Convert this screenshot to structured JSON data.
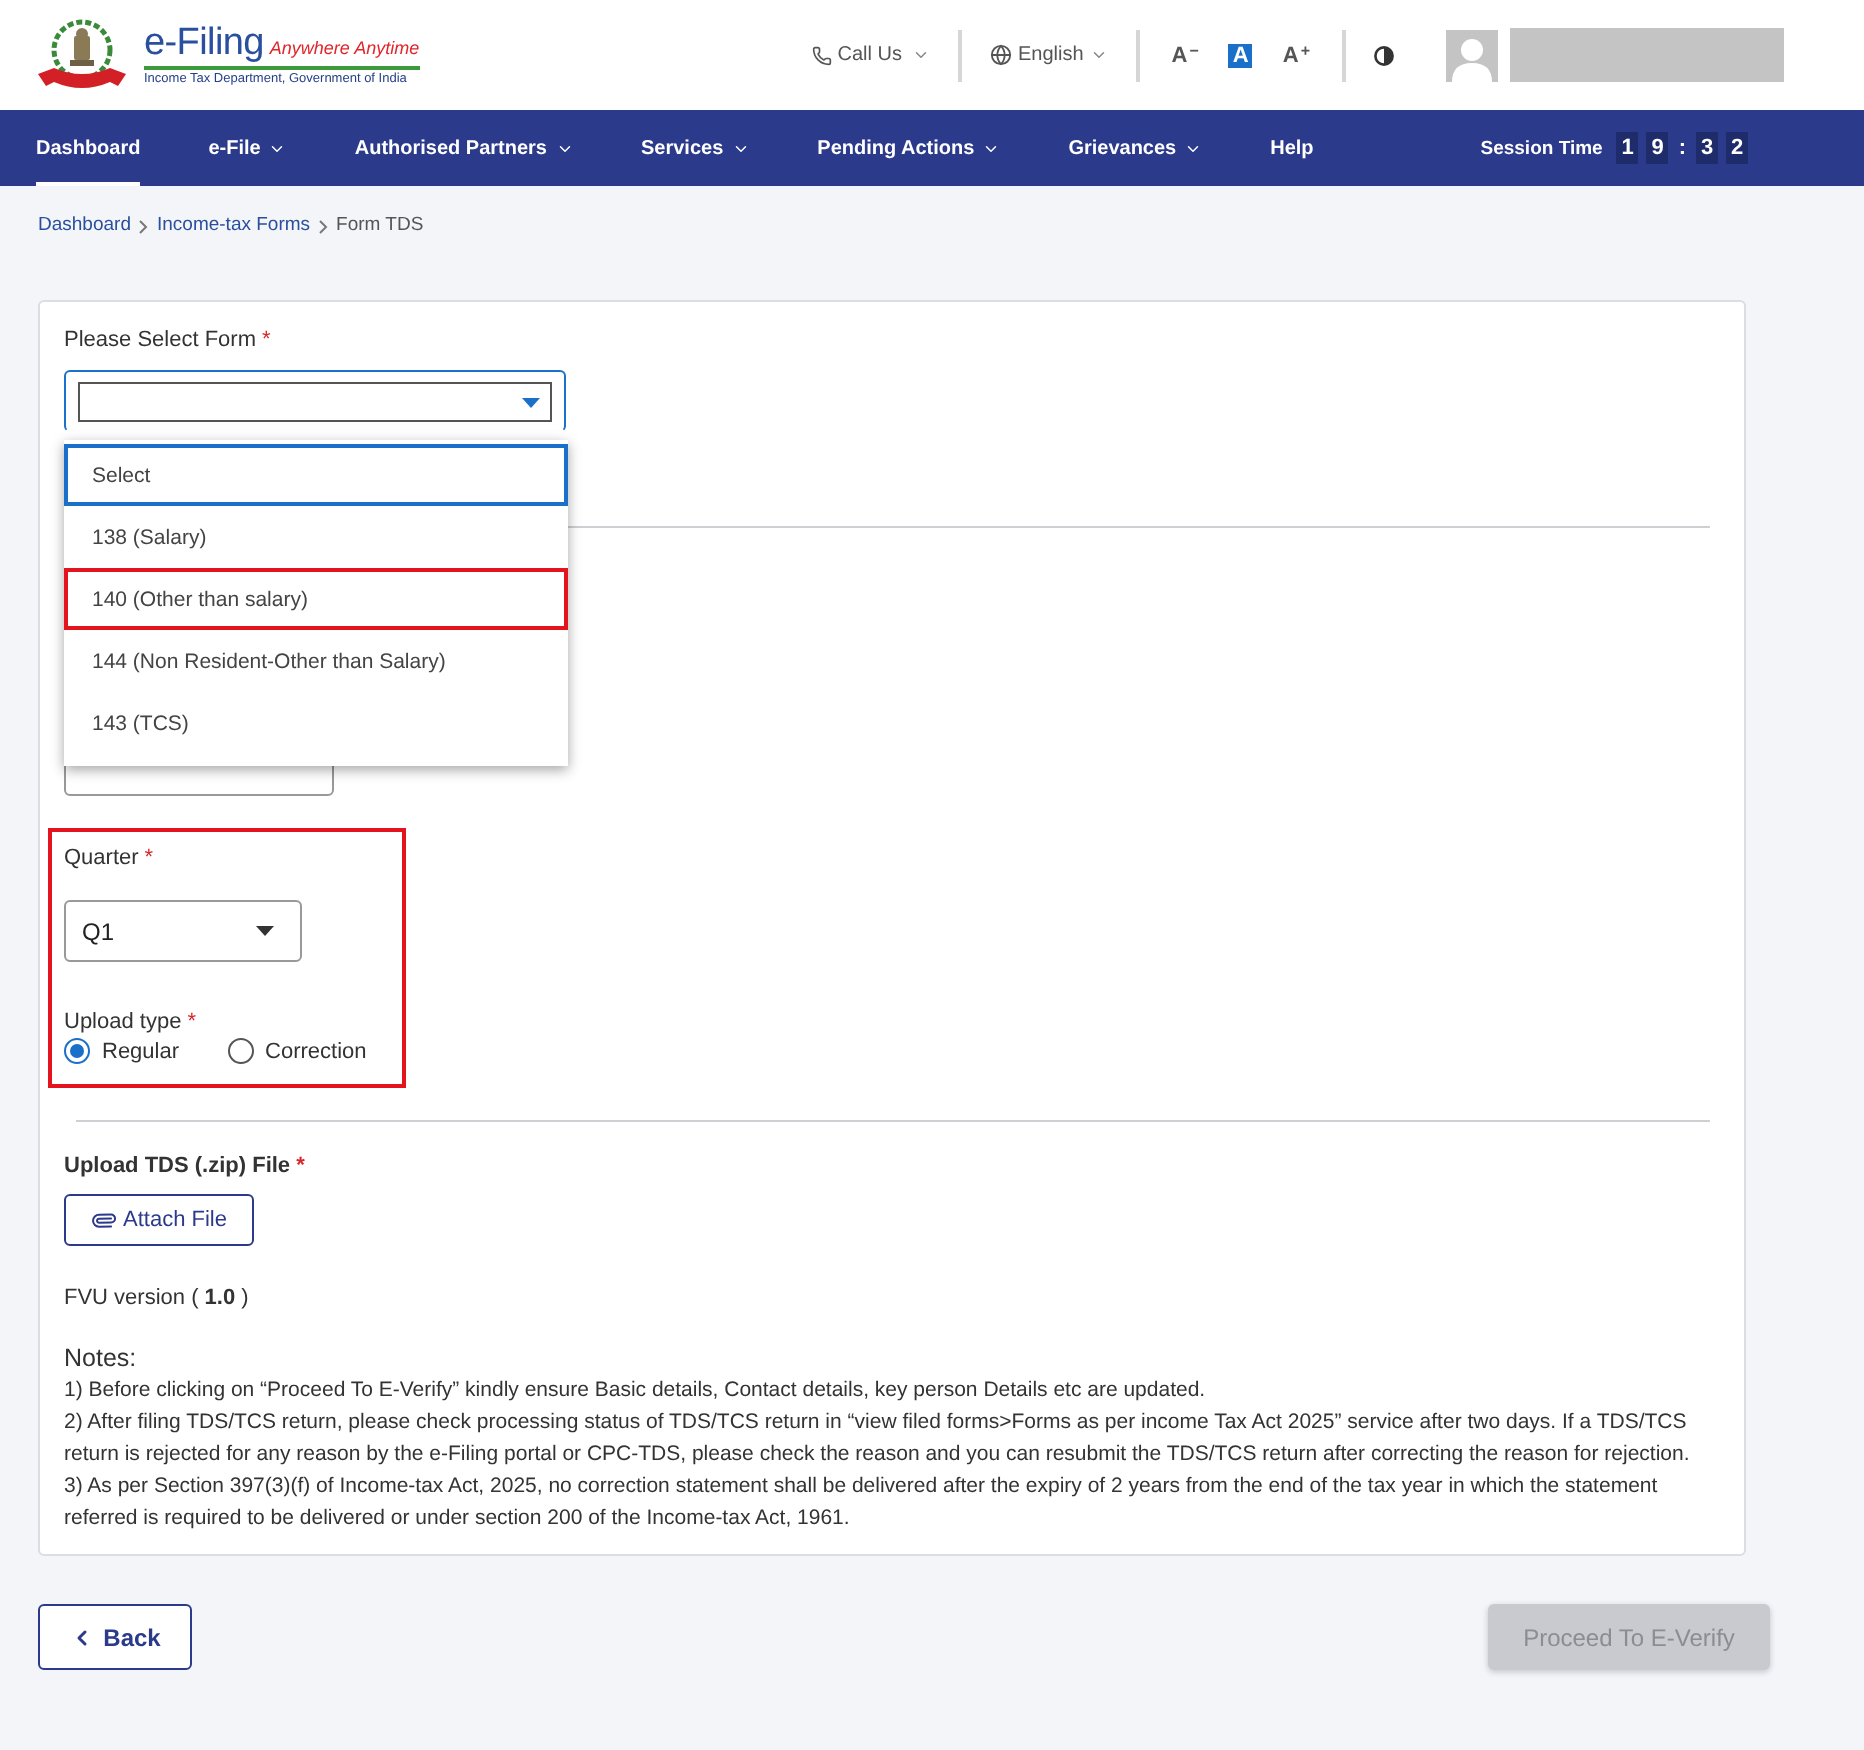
{
  "header": {
    "logo": {
      "title": "e-Filing",
      "tagline": "Anywhere Anytime",
      "subtitle": "Income Tax Department, Government of India"
    },
    "call_us": "Call Us",
    "language": "English",
    "font_sizes": [
      {
        "label": "A",
        "sign": "−",
        "selected": false
      },
      {
        "label": "A",
        "selected": true
      },
      {
        "label": "A",
        "sign": "+",
        "selected": false
      }
    ]
  },
  "nav": {
    "items": [
      {
        "label": "Dashboard",
        "dropdown": false,
        "selected": true
      },
      {
        "label": "e-File",
        "dropdown": true,
        "selected": false
      },
      {
        "label": "Authorised Partners",
        "dropdown": true,
        "selected": false
      },
      {
        "label": "Services",
        "dropdown": true,
        "selected": false
      },
      {
        "label": "Pending Actions",
        "dropdown": true,
        "selected": false
      },
      {
        "label": "Grievances",
        "dropdown": true,
        "selected": false
      },
      {
        "label": "Help",
        "dropdown": false,
        "selected": false
      }
    ],
    "session": {
      "label": "Session Time",
      "minutes": [
        "1",
        "9"
      ],
      "separator": ":",
      "seconds": [
        "3",
        "2"
      ]
    }
  },
  "breadcrumb": [
    {
      "label": "Dashboard",
      "current": false
    },
    {
      "label": "Income-tax Forms",
      "current": false
    },
    {
      "label": "Form TDS",
      "current": true
    }
  ],
  "form_select": {
    "label": "Please Select Form",
    "required_mark": "*",
    "open": true,
    "options": [
      {
        "label": "Select",
        "selected": true,
        "annotated": false
      },
      {
        "label": "138 (Salary)",
        "selected": false,
        "annotated": false
      },
      {
        "label": "140 (Other than salary)",
        "selected": false,
        "annotated": true
      },
      {
        "label": "144 (Non Resident-Other than Salary)",
        "selected": false,
        "annotated": false
      },
      {
        "label": "143 (TCS)",
        "selected": false,
        "annotated": false
      }
    ]
  },
  "quarter_section": {
    "annotated": true,
    "quarter": {
      "label": "Quarter",
      "required_mark": "*",
      "value": "Q1"
    },
    "upload_type": {
      "label": "Upload type",
      "required_mark": "*",
      "options": [
        {
          "label": "Regular",
          "selected": true
        },
        {
          "label": "Correction",
          "selected": false
        }
      ]
    }
  },
  "upload": {
    "label": "Upload TDS (.zip) File",
    "required_mark": "*",
    "button": "Attach File"
  },
  "fvu_version": "FVU version ( **1.0** )",
  "notes": {
    "title": "Notes:",
    "items": [
      "1) Before clicking on “Proceed To E-Verify” kindly ensure Basic details, Contact details, key person Details etc are updated.",
      "2) After filing TDS/TCS return, please check processing status of TDS/TCS return in “view filed forms>Forms as per income Tax Act 2025” service after two days. If a TDS/TCS return is rejected for any reason by the e-Filing portal or CPC-TDS, please check the reason and you can resubmit the TDS/TCS return after correcting the reason for rejection.",
      "3) As per Section 397(3)(f) of Income-tax Act, 2025, no correction statement shall be delivered after the expiry of 2 years from the end of the tax year in which the statement referred is required to be delivered or under section 200 of the Income-tax Act, 1961."
    ]
  },
  "actions": {
    "back": "Back",
    "proceed": {
      "label": "Proceed To E-Verify",
      "disabled": true
    }
  }
}
